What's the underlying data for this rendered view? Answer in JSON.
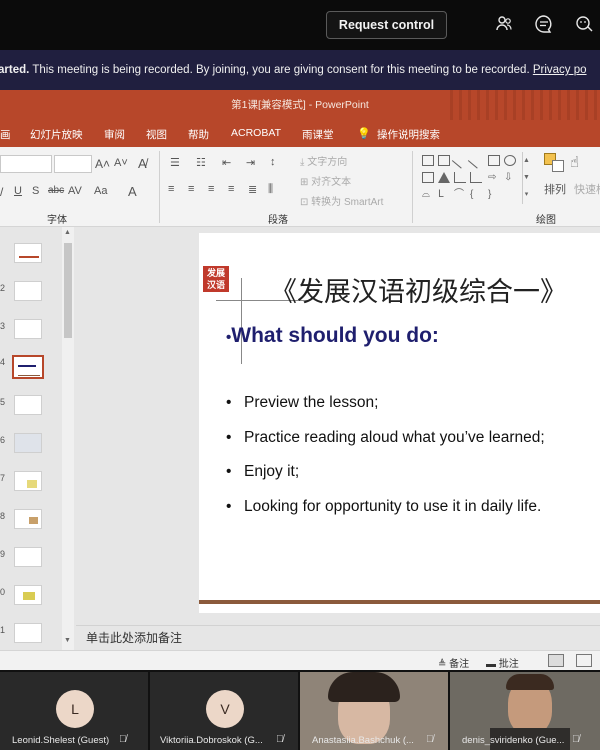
{
  "teams": {
    "request_control": "Request control",
    "icons": [
      "people-icon",
      "chat-icon",
      "reactions-icon"
    ]
  },
  "recording_banner": {
    "prefix": "arted.",
    "message": " This meeting is being recorded. By joining, you are giving consent for this meeting to be recorded. ",
    "link": "Privacy po"
  },
  "ppt": {
    "window_title": "第1课[兼容模式]  -  PowerPoint",
    "menu": [
      "画",
      "幻灯片放映",
      "审阅",
      "视图",
      "帮助",
      "ACROBAT",
      "雨课堂",
      "操作说明搜索"
    ],
    "ribbon": {
      "font_group": "字体",
      "paragraph_group": "段落",
      "drawing_group": "绘图",
      "text_direction": "文字方向",
      "align_text": "对齐文本",
      "convert_smartart": "转换为 SmartArt",
      "arrange": "排列",
      "quick_styles": "快速样"
    },
    "thumb_numbers": [
      "",
      "2",
      "3",
      "4",
      "5",
      "6",
      "7",
      "8",
      "9",
      "0",
      "1"
    ],
    "slide": {
      "logo": "发展汉语",
      "title": "《发展汉语初级综合一》",
      "heading": "What should you do:",
      "bullets": [
        "Preview the lesson;",
        "Practice reading aloud what you’ve learned;",
        "Enjoy it;",
        "Looking for opportunity to use it in daily life."
      ]
    },
    "notes_placeholder": "单击此处添加备注",
    "status": {
      "notes": "备注",
      "comments": "批注"
    }
  },
  "participants": [
    {
      "initial": "L",
      "name": "Leonid.Shelest (Guest)"
    },
    {
      "initial": "V",
      "name": "Viktoriia.Dobroskok (G..."
    },
    {
      "initial": "",
      "name": "Anastasiia.Bashchuk (..."
    },
    {
      "initial": "",
      "name": "denis_sviridenko (Gue..."
    }
  ],
  "colors": {
    "ppt_accent": "#b7472a",
    "banner_bg": "#201f3f",
    "slide_heading": "#1f1f6e"
  }
}
